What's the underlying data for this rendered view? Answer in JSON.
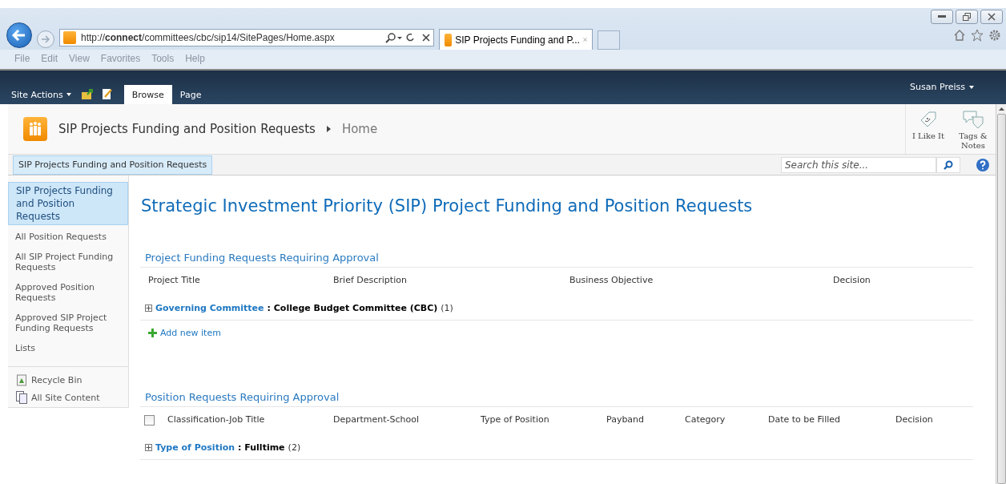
{
  "browser": {
    "url": "http://**connect**/committees/cbc/sip14/SitePages/Home.aspx",
    "tab_title": "SIP Projects Funding and P...",
    "menu": [
      "File",
      "Edit",
      "View",
      "Favorites",
      "Tools",
      "Help"
    ]
  },
  "ribbon": {
    "site_actions": "Site Actions",
    "tabs": [
      {
        "label": "Browse",
        "selected": true
      },
      {
        "label": "Page",
        "selected": false
      }
    ],
    "user": "Susan Preiss"
  },
  "header": {
    "site_title": "SIP Projects Funding and Position Requests",
    "current_page": "Home",
    "social": [
      {
        "kind": "like",
        "label": "I Like It"
      },
      {
        "kind": "tags",
        "label": "Tags & Notes"
      }
    ]
  },
  "top_nav": {
    "items": [
      {
        "label": "SIP Projects Funding and Position Requests",
        "selected": true
      }
    ],
    "search": {
      "placeholder": "Search this site..."
    }
  },
  "quick_launch": {
    "heading": {
      "label": "SIP Projects Funding and Position Requests",
      "selected": true
    },
    "items": [
      "All Position Requests",
      "All SIP Project Funding Requests",
      "Approved Position Requests",
      "Approved SIP Project Funding Requests",
      "Lists"
    ],
    "footer": [
      {
        "kind": "recycle",
        "label": "Recycle Bin"
      },
      {
        "kind": "content",
        "label": "All Site Content"
      }
    ]
  },
  "page_title": "Strategic Investment Priority (SIP) Project Funding and Position Requests",
  "sections": [
    {
      "title": "Project Funding Requests Requiring Approval",
      "columns": [
        "Project Title",
        "Brief Description",
        "Business Objective",
        "Decision"
      ],
      "group": {
        "field": "Governing Committee",
        "value": ": College Budget Committee (CBC)",
        "count": "(1)"
      },
      "add_item": "Add new item"
    },
    {
      "title": "Position Requests Requiring Approval",
      "checked": false,
      "columns": [
        "Classification-Job Title",
        "Department-School",
        "Type of Position",
        "Payband",
        "Category",
        "Date to be Filled",
        "Decision"
      ],
      "group": {
        "field": "Type of Position",
        "value": ": Fulltime",
        "count": "(2)"
      }
    }
  ]
}
